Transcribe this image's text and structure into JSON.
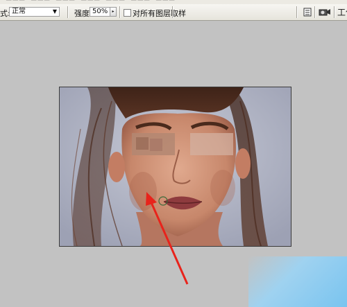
{
  "toolbar": {
    "mode_label": "式:",
    "mode_value": "正常",
    "strength_label": "强度:",
    "strength_value": "50%",
    "sample_all_layers_label": "对所有图层取样",
    "workspace_label": "工作"
  },
  "icons": {
    "dropdown": "chevron-down-icon",
    "spinner": "spinner-icon",
    "palette": "palette-well-icon",
    "brush_sample": "brush-sample-icon"
  },
  "colors": {
    "workspace_bg": "#c2c2c2",
    "toolbar_bg": "#eceae3",
    "arrow": "#e8231b"
  }
}
